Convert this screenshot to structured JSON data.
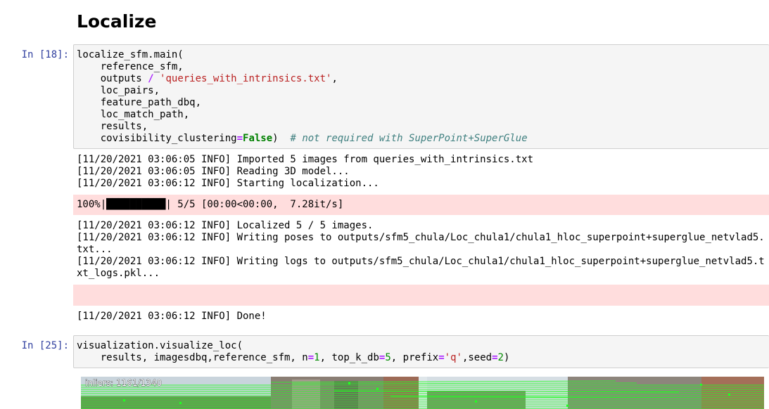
{
  "heading": "Localize",
  "cell18": {
    "prompt": "In [18]:",
    "l1": "localize_sfm.main(",
    "l2": "    reference_sfm,",
    "l3a": "    outputs ",
    "l3op": "/",
    "l3str": "'queries_with_intrinsics.txt'",
    "l3b": ",",
    "l4": "    loc_pairs,",
    "l5": "    feature_path_dbq,",
    "l6": "    loc_match_path,",
    "l7": "    results,",
    "l8a": "    covisibility_clustering",
    "l8op": "=",
    "l8kw": "False",
    "l8b": ")  ",
    "l8comment": "# not required with SuperPoint+SuperGlue"
  },
  "out18": {
    "log1": "[11/20/2021 03:06:05 INFO] Imported 5 images from queries_with_intrinsics.txt\n[11/20/2021 03:06:05 INFO] Reading 3D model...\n[11/20/2021 03:06:12 INFO] Starting localization...",
    "progress": "100%|██████████| 5/5 [00:00<00:00,  7.28it/s]",
    "log2": "[11/20/2021 03:06:12 INFO] Localized 5 / 5 images.\n[11/20/2021 03:06:12 INFO] Writing poses to outputs/sfm5_chula/Loc_chula1/chula1_hloc_superpoint+superglue_netvlad5.\ntxt...\n[11/20/2021 03:06:12 INFO] Writing logs to outputs/sfm5_chula/Loc_chula1/chula1_hloc_superpoint+superglue_netvlad5.t\nxt_logs.pkl...",
    "log3": "[11/20/2021 03:06:12 INFO] Done!"
  },
  "cell25": {
    "prompt": "In [25]:",
    "l1": "visualization.visualize_loc(",
    "l2a": "    results, imagesdbq,reference_sfm, n",
    "eq": "=",
    "n_val": "1",
    "l2b": ", top_k_db",
    "k_val": "5",
    "l2c": ", prefix",
    "prefix_val": "'q'",
    "l2d": ",seed",
    "seed_val": "2",
    "l2e": ")"
  },
  "figure": {
    "inliers_label": "inliers: 1161/1340"
  },
  "colors": {
    "prompt": "#303f9f",
    "operator": "#aa22ff",
    "string": "#ba2121",
    "keyword": "#008000",
    "comment": "#408080",
    "stderr_bg": "#ffdddd",
    "match_line": "#22ff22"
  }
}
